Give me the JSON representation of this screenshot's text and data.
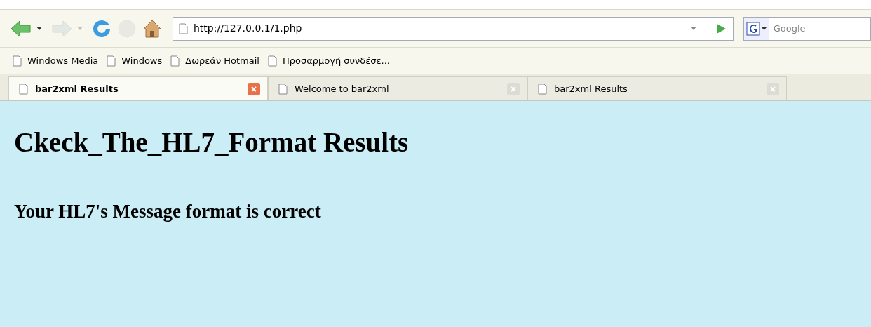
{
  "toolbar": {
    "buttons": [
      {
        "kind": "back",
        "disabled": false
      },
      {
        "kind": "forward",
        "disabled": true
      },
      {
        "kind": "reload",
        "disabled": false
      },
      {
        "kind": "stop",
        "disabled": true
      },
      {
        "kind": "home",
        "disabled": false
      }
    ],
    "url": "http://127.0.0.1/1.php",
    "search": {
      "placeholder": "Google"
    }
  },
  "bookmarks": [
    "Windows Media",
    "Windows",
    "Δωρεάν Hotmail",
    "Προσαρμογή συνδέσε..."
  ],
  "tabs": [
    {
      "label": "bar2xml Results",
      "selected": true
    },
    {
      "label": "Welcome to bar2xml",
      "selected": false
    },
    {
      "label": "bar2xml Results",
      "selected": false
    }
  ],
  "page": {
    "heading": "Ckeck_The_HL7_Format Results",
    "message": "Your HL7's Message format is correct"
  }
}
